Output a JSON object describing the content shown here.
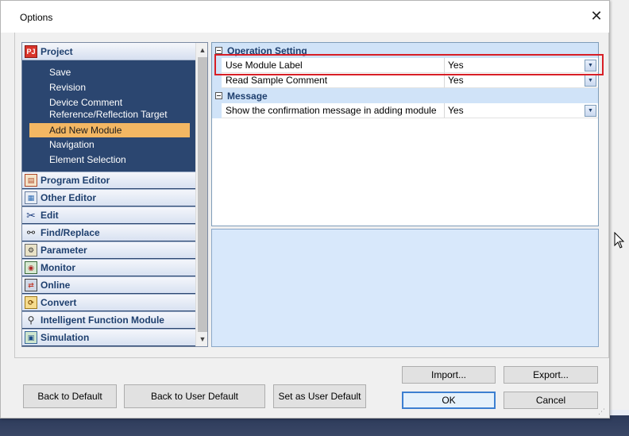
{
  "window": {
    "title": "Options",
    "close_glyph": "✕"
  },
  "nav": {
    "header": {
      "label": "Project",
      "icon": "project-icon"
    },
    "sub_items": [
      {
        "label": "Save"
      },
      {
        "label": "Revision"
      },
      {
        "label": "Device Comment"
      },
      {
        "label": "Reference/Reflection Target"
      },
      {
        "label": "Add New Module",
        "selected": true
      },
      {
        "label": "Navigation"
      },
      {
        "label": "Element Selection"
      }
    ],
    "categories": [
      {
        "label": "Program Editor",
        "icon": "program-editor-icon"
      },
      {
        "label": "Other Editor",
        "icon": "other-editor-icon"
      },
      {
        "label": "Edit",
        "icon": "scissors-icon"
      },
      {
        "label": "Find/Replace",
        "icon": "binoculars-icon"
      },
      {
        "label": "Parameter",
        "icon": "parameter-icon"
      },
      {
        "label": "Monitor",
        "icon": "monitor-icon"
      },
      {
        "label": "Online",
        "icon": "online-icon"
      },
      {
        "label": "Convert",
        "icon": "convert-icon"
      },
      {
        "label": "Intelligent Function Module",
        "icon": "intelligent-function-module-icon"
      },
      {
        "label": "Simulation",
        "icon": "simulation-icon"
      }
    ],
    "scroll_up": "▲",
    "scroll_down": "▼"
  },
  "grid": {
    "sections": [
      {
        "label": "Operation Setting",
        "rows": [
          {
            "name": "Use Module Label",
            "value": "Yes",
            "highlighted": true
          },
          {
            "name": "Read Sample Comment",
            "value": "Yes"
          }
        ]
      },
      {
        "label": "Message",
        "rows": [
          {
            "name": "Show the confirmation message in adding module",
            "value": "Yes"
          }
        ]
      }
    ],
    "dropdown_glyph": "▼"
  },
  "buttons": {
    "import": "Import...",
    "export": "Export...",
    "back_to_default": "Back to Default",
    "back_to_user_default": "Back to User Default",
    "set_as_user_default": "Set as User Default",
    "ok": "OK",
    "cancel": "Cancel"
  },
  "colors": {
    "nav_background": "#2b4670",
    "selection": "#f3b763",
    "section_fill": "#d0e3f8",
    "highlight_border": "#d81f26"
  }
}
